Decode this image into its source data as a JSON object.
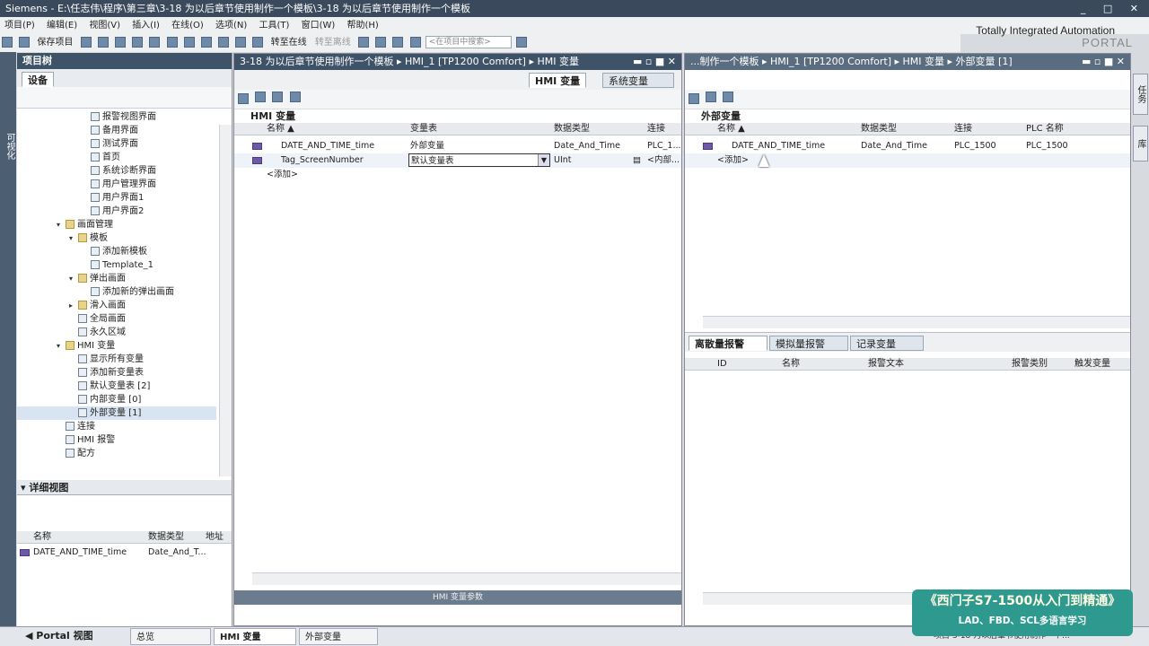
{
  "window": {
    "title": "Siemens  -  E:\\任志伟\\程序\\第三章\\3-18 为以后章节使用制作一个模板\\3-18 为以后章节使用制作一个模板"
  },
  "menu": [
    "项目(P)",
    "编辑(E)",
    "视图(V)",
    "插入(I)",
    "在线(O)",
    "选项(N)",
    "工具(T)",
    "窗口(W)",
    "帮助(H)"
  ],
  "toolbar": {
    "save": "保存项目",
    "go_online": "转至在线",
    "go_offline": "转至离线",
    "search_placeholder": "<在项目中搜索>"
  },
  "brand": {
    "line1": "Totally Integrated Automation",
    "line2": "PORTAL"
  },
  "left_strip_label": "可视化",
  "project_tree": {
    "header": "项目树",
    "tab": "设备",
    "items": [
      {
        "label": "报警视图界面",
        "indent": 3
      },
      {
        "label": "备用界面",
        "indent": 3
      },
      {
        "label": "测试界面",
        "indent": 3
      },
      {
        "label": "首页",
        "indent": 3
      },
      {
        "label": "系统诊断界面",
        "indent": 3
      },
      {
        "label": "用户管理界面",
        "indent": 3
      },
      {
        "label": "用户界面1",
        "indent": 3
      },
      {
        "label": "用户界面2",
        "indent": 3
      },
      {
        "label": "画面管理",
        "indent": 1,
        "expanded": true
      },
      {
        "label": "模板",
        "indent": 2,
        "expanded": true
      },
      {
        "label": "添加新模板",
        "indent": 3
      },
      {
        "label": "Template_1",
        "indent": 3
      },
      {
        "label": "弹出画面",
        "indent": 2,
        "expanded": true
      },
      {
        "label": "添加新的弹出画面",
        "indent": 3
      },
      {
        "label": "滑入画面",
        "indent": 2,
        "expanded": false
      },
      {
        "label": "全局画面",
        "indent": 2
      },
      {
        "label": "永久区域",
        "indent": 2
      },
      {
        "label": "HMI 变量",
        "indent": 1,
        "expanded": true
      },
      {
        "label": "显示所有变量",
        "indent": 2
      },
      {
        "label": "添加新变量表",
        "indent": 2
      },
      {
        "label": "默认变量表 [2]",
        "indent": 2
      },
      {
        "label": "内部变量 [0]",
        "indent": 2
      },
      {
        "label": "外部变量 [1]",
        "indent": 2,
        "selected": true
      },
      {
        "label": "连接",
        "indent": 1
      },
      {
        "label": "HMI 报警",
        "indent": 1
      },
      {
        "label": "配方",
        "indent": 1
      }
    ]
  },
  "detail_view": {
    "header": "详细视图",
    "columns": [
      "名称",
      "数据类型",
      "地址"
    ],
    "rows": [
      {
        "name": "DATE_AND_TIME_time",
        "type": "Date_And_T...",
        "addr": ""
      }
    ]
  },
  "center": {
    "breadcrumb": "3-18 为以后章节使用制作一个模板  ▸  HMI_1 [TP1200 Comfort]  ▸  HMI 变量",
    "tabs": [
      "HMI 变量",
      "系统变量"
    ],
    "table_title": "HMI 变量",
    "columns": [
      "名称 ▲",
      "变量表",
      "数据类型",
      "连接"
    ],
    "rows": [
      {
        "name": "DATE_AND_TIME_time",
        "table": "外部变量",
        "type": "Date_And_Time",
        "conn": "PLC_1..."
      },
      {
        "name": "Tag_ScreenNumber",
        "table": "默认变量表",
        "type": "UInt",
        "conn": "<内部..."
      }
    ],
    "add_row": "<添加>",
    "footer": "HMI 变量参数"
  },
  "right": {
    "breadcrumb": "...制作一个模板  ▸  HMI_1 [TP1200 Comfort]  ▸  HMI 变量  ▸  外部变量 [1]",
    "table_title": "外部变量",
    "columns": [
      "名称 ▲",
      "数据类型",
      "连接",
      "PLC 名称"
    ],
    "rows": [
      {
        "name": "DATE_AND_TIME_time",
        "type": "Date_And_Time",
        "conn": "PLC_1500",
        "plc": "PLC_1500"
      }
    ],
    "add_row": "<添加>",
    "bottom_tabs": [
      "离散量报警",
      "模拟量报警",
      "记录变量"
    ],
    "bottom_columns": [
      "ID",
      "名称",
      "报警文本",
      "报警类别",
      "触发变量"
    ]
  },
  "side_tabs": [
    "任务",
    "库"
  ],
  "taskbar": {
    "portal": "Portal 视图",
    "items": [
      "总览",
      "HMI 变量",
      "外部变量"
    ],
    "right_text": "项目 3-18 为以后章节使用制作一个..."
  },
  "promo": {
    "line1": "《西门子S7-1500从入门到精通》",
    "line2": "LAD、FBD、SCL多语言学习"
  }
}
